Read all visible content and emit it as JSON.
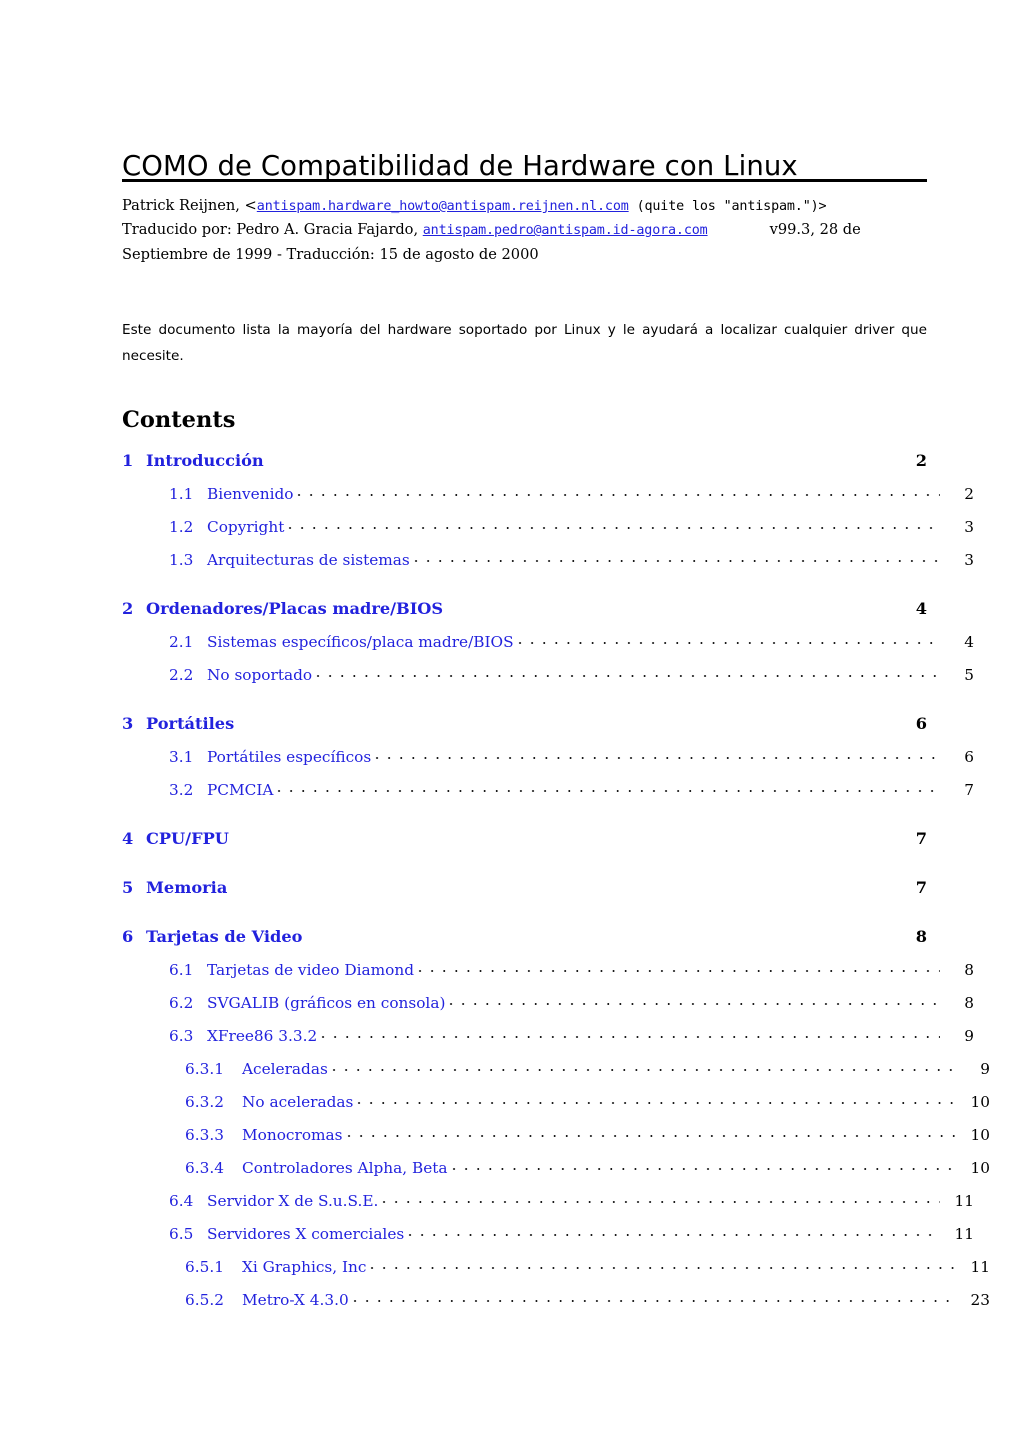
{
  "document": {
    "title": "COMO de Compatibilidad de Hardware con Linux",
    "rule_color": "#000000",
    "link_color": "#2222dd"
  },
  "author_block": {
    "line1_pre": "Patrick Reijnen, <",
    "line1_email": "antispam.hardware_howto@antispam.reijnen.nl.com",
    "line1_post": " (quite los \"antispam.\")>",
    "line2_pre": "Traducido por: Pedro A. Gracia Fajardo, ",
    "line2_email": "antispam.pedro@antispam.id-agora.com",
    "line2_post": "v99.3, 28 de",
    "line3": "Septiembre de 1999 - Traducción: 15 de agosto de 2000"
  },
  "abstract": {
    "text": "Este documento lista la mayoría del hardware soportado por Linux y le ayudará a localizar cualquier driver que necesite."
  },
  "contents": {
    "heading": "Contents",
    "entries": [
      {
        "level": 1,
        "number": "1",
        "title": "Introducción",
        "page": "2"
      },
      {
        "level": 2,
        "number": "1.1",
        "title": "Bienvenido",
        "page": "2"
      },
      {
        "level": 2,
        "number": "1.2",
        "title": "Copyright",
        "page": "3"
      },
      {
        "level": 2,
        "number": "1.3",
        "title": "Arquitecturas de sistemas",
        "page": "3"
      },
      {
        "level": 1,
        "number": "2",
        "title": "Ordenadores/Placas madre/BIOS",
        "page": "4"
      },
      {
        "level": 2,
        "number": "2.1",
        "title": "Sistemas específicos/placa madre/BIOS",
        "page": "4"
      },
      {
        "level": 2,
        "number": "2.2",
        "title": "No soportado",
        "page": "5"
      },
      {
        "level": 1,
        "number": "3",
        "title": "Portátiles",
        "page": "6"
      },
      {
        "level": 2,
        "number": "3.1",
        "title": "Portátiles específicos",
        "page": "6"
      },
      {
        "level": 2,
        "number": "3.2",
        "title": "PCMCIA",
        "page": "7"
      },
      {
        "level": 1,
        "number": "4",
        "title": "CPU/FPU",
        "page": "7"
      },
      {
        "level": 1,
        "number": "5",
        "title": "Memoria",
        "page": "7"
      },
      {
        "level": 1,
        "number": "6",
        "title": "Tarjetas de Video",
        "page": "8"
      },
      {
        "level": 2,
        "number": "6.1",
        "title": "Tarjetas de video Diamond",
        "page": "8"
      },
      {
        "level": 2,
        "number": "6.2",
        "title": "SVGALIB (gráficos en consola)",
        "page": "8"
      },
      {
        "level": 2,
        "number": "6.3",
        "title": "XFree86 3.3.2",
        "page": "9"
      },
      {
        "level": 3,
        "number": "6.3.1",
        "title": "Aceleradas",
        "page": "9"
      },
      {
        "level": 3,
        "number": "6.3.2",
        "title": "No aceleradas",
        "page": "10"
      },
      {
        "level": 3,
        "number": "6.3.3",
        "title": "Monocromas",
        "page": "10"
      },
      {
        "level": 3,
        "number": "6.3.4",
        "title": "Controladores Alpha, Beta",
        "page": "10"
      },
      {
        "level": 2,
        "number": "6.4",
        "title": "Servidor X de S.u.S.E.",
        "page": "11"
      },
      {
        "level": 2,
        "number": "6.5",
        "title": "Servidores X comerciales",
        "page": "11"
      },
      {
        "level": 3,
        "number": "6.5.1",
        "title": "Xi Graphics, Inc",
        "page": "11"
      },
      {
        "level": 3,
        "number": "6.5.2",
        "title": "Metro-X 4.3.0",
        "page": "23"
      }
    ]
  }
}
